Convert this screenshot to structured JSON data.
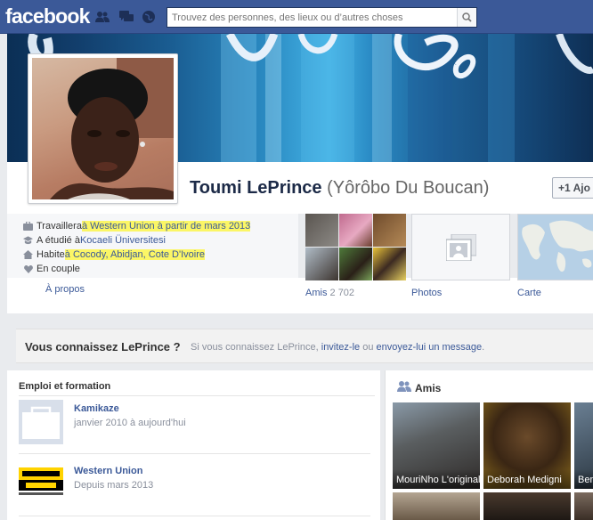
{
  "topbar": {
    "logo": "facebook",
    "search_placeholder": "Trouvez des personnes, des lieux ou d’autres choses",
    "jewels": [
      "friend-requests-icon",
      "messages-icon",
      "notifications-icon"
    ]
  },
  "profile": {
    "name": "Toumi LePrince",
    "alt_name": "(Yôrôbo Du Boucan)",
    "add_button": "+1 Ajo"
  },
  "info": {
    "work_prefix": "Travaillera ",
    "work_highlight": "à Western Union à partir de mars 2013",
    "study_prefix": "A étudié à ",
    "study_link": "Kocaeli Üniversitesi",
    "lives_prefix": "Habite ",
    "lives_highlight": "à Cocody, Abidjan, Cote D'Ivoire",
    "relationship": "En couple",
    "about_link": "À propos"
  },
  "tiles": {
    "friends_label": "Amis",
    "friends_count": "2 702",
    "photos_label": "Photos",
    "map_label": "Carte"
  },
  "know_bar": {
    "title": "Vous connaissez LePrince ?",
    "text_prefix": "Si vous connaissez LePrince, ",
    "invite_link": "invitez-le",
    "or_text": " ou ",
    "message_link": "envoyez-lui un message",
    "period": "."
  },
  "emploi": {
    "title": "Emploi et formation",
    "jobs": [
      {
        "name": "Kamikaze",
        "dates": "janvier 2010 à aujourd'hui"
      },
      {
        "name": "Western Union",
        "dates": "Depuis mars 2013"
      }
    ]
  },
  "amis": {
    "title": "Amis",
    "friends": [
      "MouriNho L'original",
      "Deborah Medigni",
      "Ben"
    ]
  },
  "colors": {
    "brand": "#3b5998",
    "highlight": "#fbf666",
    "link": "#3b5998"
  }
}
